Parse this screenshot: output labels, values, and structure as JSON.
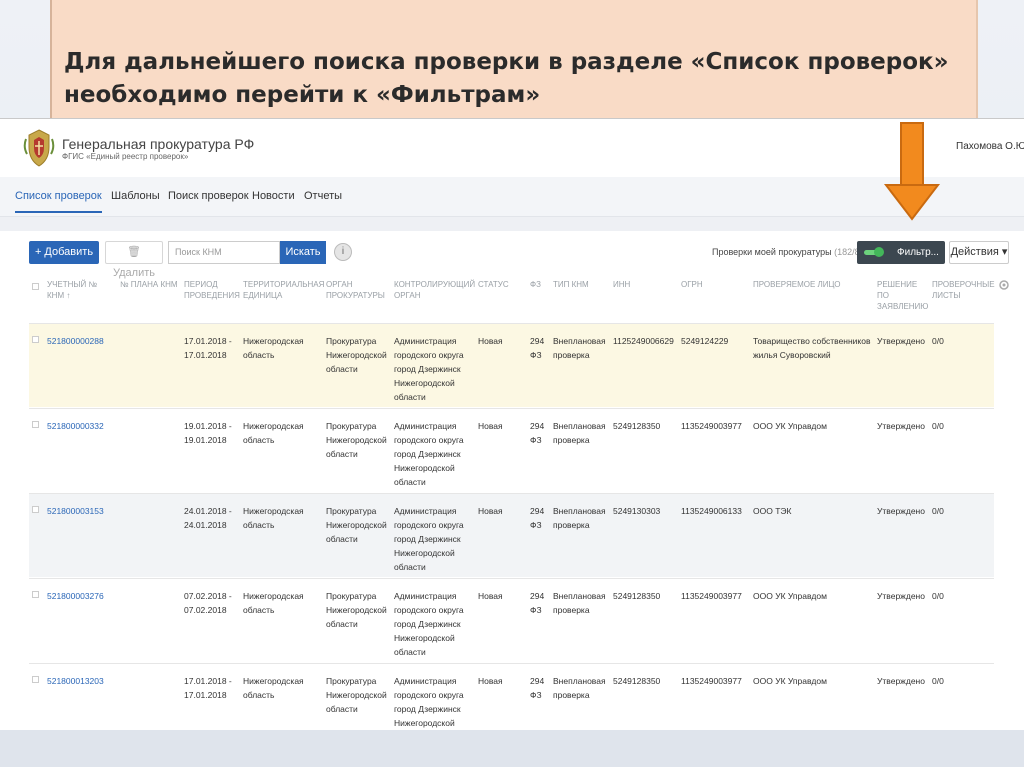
{
  "banner": {
    "line1": "Для дальнейшего поиска проверки в разделе «Список проверок»",
    "line2": "необходимо перейти к «Фильтрам»"
  },
  "header": {
    "title": "Генеральная прокуратура РФ",
    "subtitle": "ФГИС «Единый реестр проверок»",
    "user": "Пахомова О.Ю."
  },
  "nav": [
    "Список проверок",
    "Шаблоны",
    "Поиск проверок",
    "Новости",
    "Отчеты"
  ],
  "toolbar": {
    "add": "+ Добавить",
    "delete": "Удалить",
    "search_placeholder": "Поиск КНМ",
    "search": "Искать",
    "info": "i",
    "my_checks": "Проверки моей прокуратуры",
    "my_checks_count": "(182/8)",
    "filter": "Фильтр...",
    "actions": "Действия"
  },
  "table": {
    "headers": [
      "Учетный № КНМ ↑",
      "№ плана КНМ",
      "Период проведения",
      "Территориальная единица",
      "Орган прокуратуры",
      "Контролирующий орган",
      "Статус",
      "ФЗ",
      "Тип КНМ",
      "ИНН",
      "ОГРН",
      "Проверяемое лицо",
      "Решение по заявлению",
      "Проверочные листы"
    ],
    "rows": [
      {
        "num": "521800000288",
        "period": "17.01.2018 - 17.01.2018",
        "territory": "Нижегородская область",
        "prosecutor": "Прокуратура Нижегородской области",
        "control": "Администрация городского округа город Дзержинск Нижегородской области",
        "status": "Новая",
        "fz": "294 ФЗ",
        "type": "Внеплановая проверка",
        "inn": "1125249006629",
        "ogrn": "5249124229",
        "person": "Товарищество собственников жилья Суворовский",
        "decision": "Утверждено",
        "sheets": "0/0"
      },
      {
        "num": "521800000332",
        "period": "19.01.2018 - 19.01.2018",
        "territory": "Нижегородская область",
        "prosecutor": "Прокуратура Нижегородской области",
        "control": "Администрация городского округа город Дзержинск Нижегородской области",
        "status": "Новая",
        "fz": "294 ФЗ",
        "type": "Внеплановая проверка",
        "inn": "5249128350",
        "ogrn": "1135249003977",
        "person": "ООО УК Управдом",
        "decision": "Утверждено",
        "sheets": "0/0"
      },
      {
        "num": "521800003153",
        "period": "24.01.2018 - 24.01.2018",
        "territory": "Нижегородская область",
        "prosecutor": "Прокуратура Нижегородской области",
        "control": "Администрация городского округа город Дзержинск Нижегородской области",
        "status": "Новая",
        "fz": "294 ФЗ",
        "type": "Внеплановая проверка",
        "inn": "5249130303",
        "ogrn": "1135249006133",
        "person": "ООО ТЭК",
        "decision": "Утверждено",
        "sheets": "0/0"
      },
      {
        "num": "521800003276",
        "period": "07.02.2018 - 07.02.2018",
        "territory": "Нижегородская область",
        "prosecutor": "Прокуратура Нижегородской области",
        "control": "Администрация городского округа город Дзержинск Нижегородской области",
        "status": "Новая",
        "fz": "294 ФЗ",
        "type": "Внеплановая проверка",
        "inn": "5249128350",
        "ogrn": "1135249003977",
        "person": "ООО УК Управдом",
        "decision": "Утверждено",
        "sheets": "0/0"
      },
      {
        "num": "521800013203",
        "period": "17.01.2018 - 17.01.2018",
        "territory": "Нижегородская область",
        "prosecutor": "Прокуратура Нижегородской области",
        "control": "Администрация городского округа город Дзержинск Нижегородской",
        "status": "Новая",
        "fz": "294 ФЗ",
        "type": "Внеплановая проверка",
        "inn": "5249128350",
        "ogrn": "1135249003977",
        "person": "ООО УК Управдом",
        "decision": "Утверждено",
        "sheets": "0/0"
      }
    ]
  },
  "colors": {
    "accent": "#2a66b7",
    "highlight_row": "#fcf8e3",
    "arrow": "#f28a1e",
    "banner": "#f9dbc6"
  }
}
